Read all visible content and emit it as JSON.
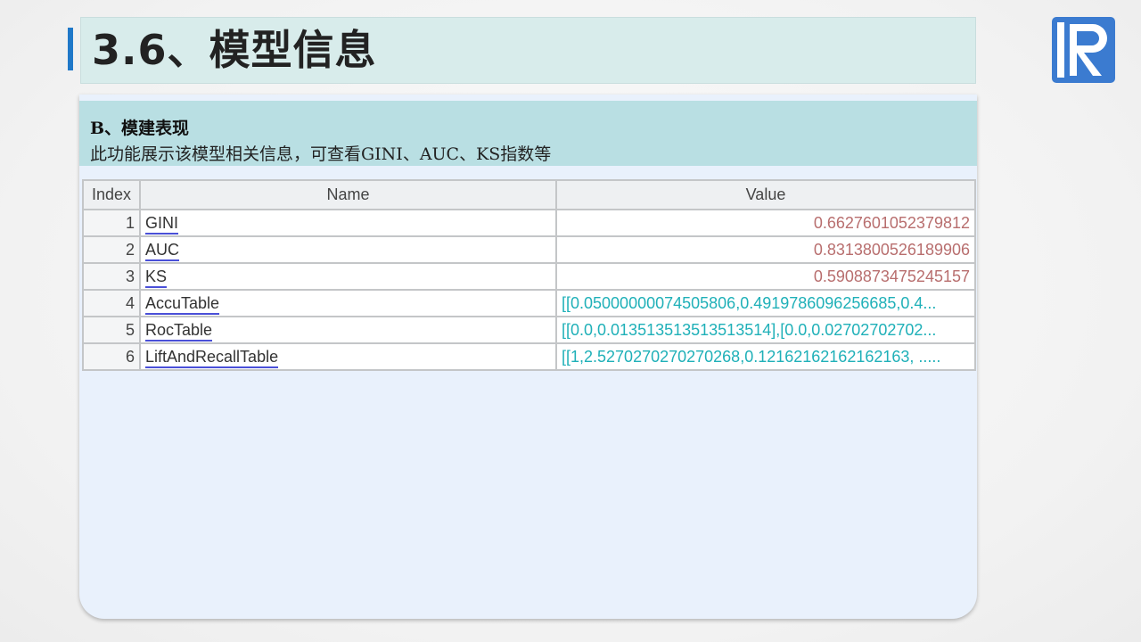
{
  "slide": {
    "title": "3.6、模型信息",
    "logo_icon": "raqsoft-r-logo-icon",
    "accent_color": "#1f78c8"
  },
  "section": {
    "title": "B、模建表现",
    "description": "此功能展示该模型相关信息，可查看GINI、AUC、KS指数等"
  },
  "table": {
    "headers": [
      "Index",
      "Name",
      "Value"
    ],
    "rows": [
      {
        "index": "1",
        "name": "GINI",
        "value": "0.6627601052379812"
      },
      {
        "index": "2",
        "name": "AUC",
        "value": "0.8313800526189906"
      },
      {
        "index": "3",
        "name": "KS",
        "value": "0.5908873475245157"
      },
      {
        "index": "4",
        "name": "AccuTable",
        "value": "[[0.05000000074505806,0.491978609625668​5,0.4..."
      },
      {
        "index": "5",
        "name": "RocTable",
        "value": "[[0.0,0.0135135135135135​14],[0.0,0.02702702702..."
      },
      {
        "index": "6",
        "name": "LiftAndRecallTable",
        "value": "[[1,2.5270270270270268,0.12162162162162163, ....."
      }
    ]
  }
}
